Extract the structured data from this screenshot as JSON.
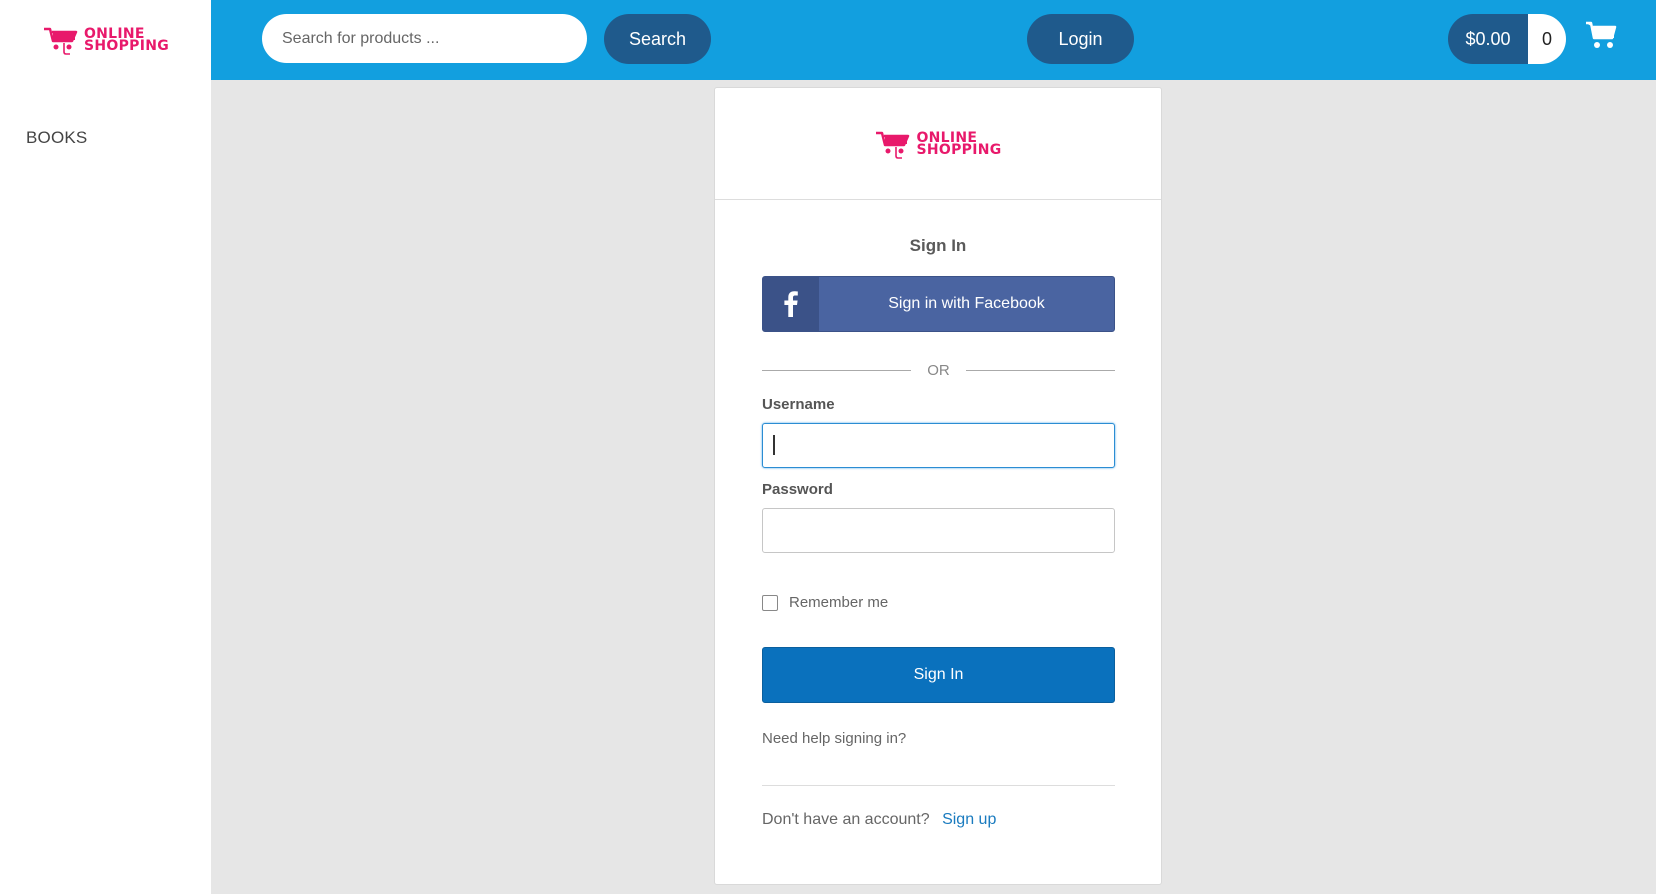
{
  "brand": {
    "line1": "ONLINE",
    "line2": "SHOPPING",
    "color": "#e8196b"
  },
  "sidebar": {
    "items": [
      {
        "label": "BOOKS"
      }
    ]
  },
  "header": {
    "search_placeholder": "Search for products ...",
    "search_label": "Search",
    "login_label": "Login",
    "cart_amount": "$0.00",
    "cart_count": "0",
    "bar_color": "#129fdf",
    "button_color": "#1f5a8c"
  },
  "signin": {
    "title": "Sign In",
    "facebook_label": "Sign in with Facebook",
    "or_text": "OR",
    "username_label": "Username",
    "username_value": "",
    "password_label": "Password",
    "password_value": "",
    "remember_label": "Remember me",
    "remember_checked": false,
    "submit_label": "Sign In",
    "help_link": "Need help signing in?",
    "no_account_text": "Don't have an account?",
    "signup_link": "Sign up"
  },
  "icons": [
    "cart-logo-icon",
    "facebook-icon",
    "shopping-cart-icon"
  ]
}
